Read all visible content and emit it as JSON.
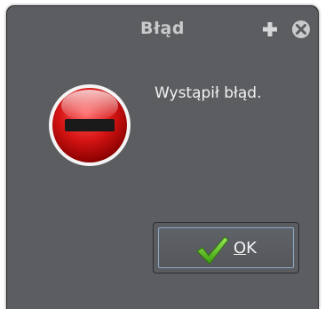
{
  "dialog": {
    "title": "Błąd",
    "message": "Wystąpił błąd.",
    "ok_button": {
      "mnemonic": "O",
      "rest": "K"
    }
  },
  "icons": {
    "title_plus": "plus-icon",
    "title_close": "close-circle-icon",
    "error": "error-stop-icon",
    "check": "checkmark-icon"
  },
  "colors": {
    "window_bg": "#5b5d60",
    "error_red": "#d81818",
    "check_green": "#5cc814"
  }
}
